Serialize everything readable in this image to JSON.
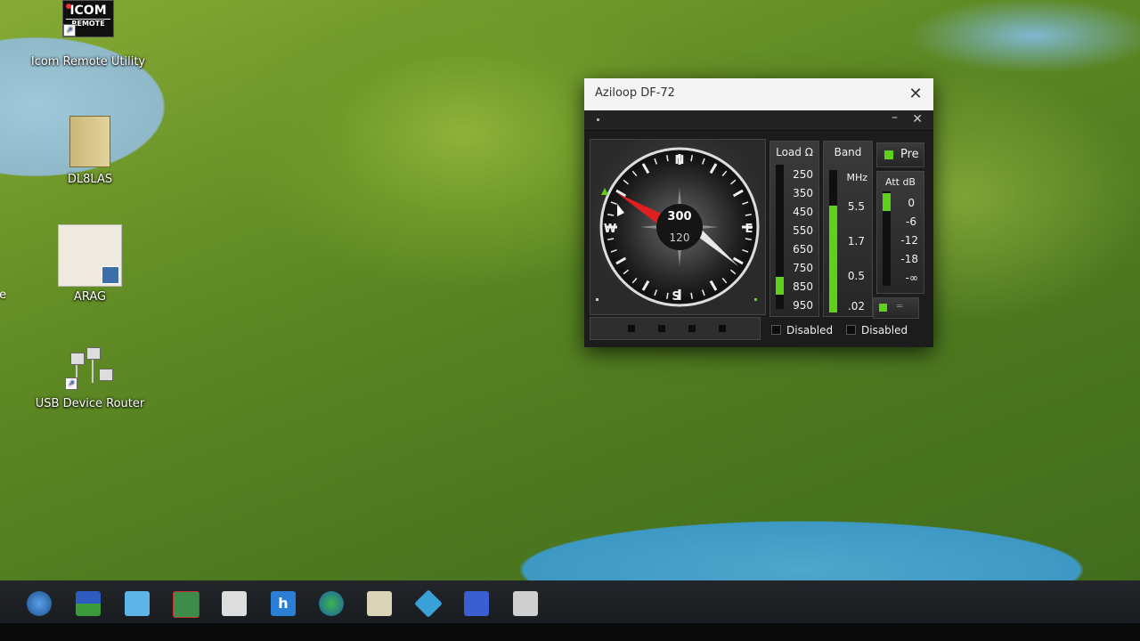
{
  "desktop": {
    "icons": [
      {
        "label": "Icom Remote Utility",
        "img_text_1": "ICOM",
        "img_text_2": "REMOTE"
      },
      {
        "label": "DL8LAS"
      },
      {
        "label": "ARAG"
      },
      {
        "label": "USB Device Router"
      }
    ],
    "edge_label": "te"
  },
  "window": {
    "title": "Aziloop DF-72",
    "close": "✕",
    "inner_min": "–",
    "inner_close": "✕",
    "compass": {
      "cardinals": {
        "n": "N",
        "s": "S",
        "e": "E",
        "w": "W"
      },
      "bearing_primary": "300",
      "bearing_secondary": "120",
      "needle_color": "#e02020",
      "tail_color": "#e8e8e8"
    },
    "load": {
      "header": "Load Ω",
      "scale": [
        "250",
        "350",
        "450",
        "550",
        "650",
        "750",
        "850",
        "950"
      ],
      "active_value": "850"
    },
    "band": {
      "header": "Band",
      "unit": "MHz",
      "scale": [
        "5.5",
        "1.7",
        "0.5",
        ".02"
      ],
      "level_fraction": 0.75
    },
    "pre": {
      "label": "Pre",
      "on": true
    },
    "att": {
      "header": "Att dB",
      "scale": [
        "0",
        "-6",
        "-12",
        "-18",
        "-∞"
      ],
      "active": "0"
    },
    "checkboxes": [
      {
        "label": "Disabled"
      },
      {
        "label": "Disabled"
      }
    ],
    "accent": "#5ed21a"
  },
  "taskbar": {
    "icons": [
      "globe-icon",
      "window-icon",
      "mail-icon",
      "map-icon",
      "radio-icon",
      "h-app-icon",
      "earth-icon",
      "scanner-icon",
      "arrow-app-icon",
      "usb-app-icon",
      "usb-router-app-icon"
    ]
  }
}
